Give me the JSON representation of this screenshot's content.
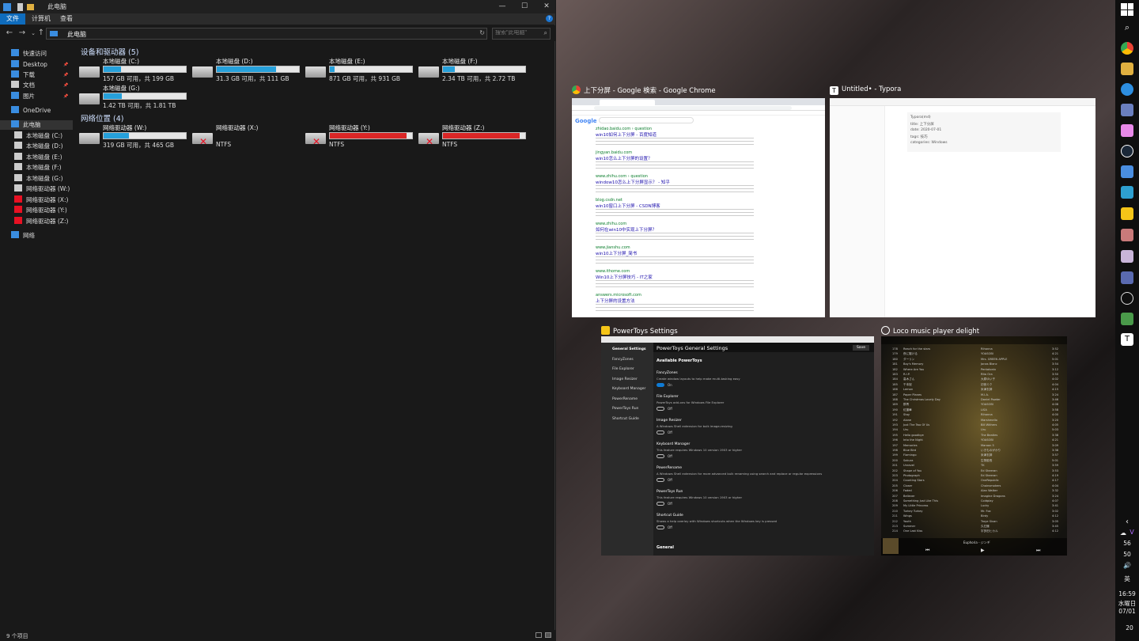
{
  "explorer": {
    "title": "此电脑",
    "ribbon_tabs": [
      "文件",
      "计算机",
      "查看"
    ],
    "address": "此电脑",
    "search_placeholder": "搜索\"此电脑\"",
    "sidebar": [
      {
        "label": "快速访问",
        "icon": "star-icon",
        "color": "#3a8de0"
      },
      {
        "label": "Desktop",
        "icon": "desktop-icon",
        "color": "#3a8de0",
        "pinned": true
      },
      {
        "label": "下载",
        "icon": "download-icon",
        "color": "#3a8de0",
        "pinned": true
      },
      {
        "label": "文档",
        "icon": "document-icon",
        "color": "#cccccc",
        "pinned": true
      },
      {
        "label": "图片",
        "icon": "picture-icon",
        "color": "#3a8de0",
        "pinned": true
      },
      {
        "label": "OneDrive",
        "icon": "cloud-icon",
        "color": "#3a8de0"
      },
      {
        "label": "此电脑",
        "icon": "computer-icon",
        "color": "#3a8de0",
        "selected": true
      },
      {
        "label": "本地磁盘 (C:)",
        "icon": "drive-icon",
        "color": "#cccccc"
      },
      {
        "label": "本地磁盘 (D:)",
        "icon": "drive-icon",
        "color": "#cccccc"
      },
      {
        "label": "本地磁盘 (E:)",
        "icon": "drive-icon",
        "color": "#cccccc"
      },
      {
        "label": "本地磁盘 (F:)",
        "icon": "drive-icon",
        "color": "#cccccc"
      },
      {
        "label": "本地磁盘 (G:)",
        "icon": "drive-icon",
        "color": "#cccccc"
      },
      {
        "label": "网络驱动器 (W:)",
        "icon": "network-drive-icon",
        "color": "#cccccc"
      },
      {
        "label": "网络驱动器 (X:)",
        "icon": "network-drive-icon",
        "color": "#e81123"
      },
      {
        "label": "网络驱动器 (Y:)",
        "icon": "network-drive-icon",
        "color": "#e81123"
      },
      {
        "label": "网络驱动器 (Z:)",
        "icon": "network-drive-icon",
        "color": "#e81123"
      },
      {
        "label": "网络",
        "icon": "network-icon",
        "color": "#3a8de0"
      }
    ],
    "section_devices": "设备和驱动器 (5)",
    "section_network": "网络位置 (4)",
    "drives": [
      {
        "name": "本地磁盘 (C:)",
        "info": "157 GB 可用，共 199 GB",
        "used": 0.21
      },
      {
        "name": "本地磁盘 (D:)",
        "info": "31.3 GB 可用，共 111 GB",
        "used": 0.72
      },
      {
        "name": "本地磁盘 (E:)",
        "info": "871 GB 可用，共 931 GB",
        "used": 0.06
      },
      {
        "name": "本地磁盘 (F:)",
        "info": "2.34 TB 可用，共 2.72 TB",
        "used": 0.14
      },
      {
        "name": "本地磁盘 (G:)",
        "info": "1.42 TB 可用，共 1.81 TB",
        "used": 0.22
      }
    ],
    "network_drives": [
      {
        "name": "网络驱动器 (W:)",
        "info": "319 GB 可用，共 465 GB",
        "used": 0.31,
        "disconnected": false
      },
      {
        "name": "网络驱动器 (X:)",
        "info": "NTFS",
        "used": 0,
        "disconnected": true
      },
      {
        "name": "网络驱动器 (Y:)",
        "info": "NTFS",
        "used": 0.93,
        "disconnected": true
      },
      {
        "name": "网络驱动器 (Z:)",
        "info": "NTFS",
        "used": 0.93,
        "disconnected": true
      }
    ],
    "status": "9 个项目"
  },
  "windows": {
    "chrome": {
      "title": "上下分屏 - Google 検索 - Google Chrome"
    },
    "typora": {
      "title": "Untitled• - Typora"
    },
    "powertoys": {
      "title": "PowerToys Settings"
    },
    "loco": {
      "title": "Loco music player delight"
    }
  },
  "chrome_results": [
    {
      "url": "zhidao.baidu.com › question",
      "title": "win10如何上下分屏 - 百度知道"
    },
    {
      "url": "jingyan.baidu.com",
      "title": "win10怎么上下分屏的设置？"
    },
    {
      "url": "www.zhihu.com › question",
      "title": "window10怎么上下分屏显示？ - 知乎"
    },
    {
      "url": "blog.csdn.net",
      "title": "win10窗口上下分屏 - CSDN博客"
    },
    {
      "url": "www.zhihu.com",
      "title": "如何在win10中实现上下分屏？"
    },
    {
      "url": "www.jianshu.com",
      "title": "win10上下分屏_简书"
    },
    {
      "url": "www.ithome.com",
      "title": "Win10上下分屏技巧 - IT之家"
    },
    {
      "url": "answers.microsoft.com",
      "title": "上下分屏的设置方法"
    }
  ],
  "typora_meta": [
    "Typora(md)",
    "title: 上下分屏",
    "date: 2020-07-01",
    "tags: 技巧",
    "categories: Windows"
  ],
  "powertoys": {
    "header": "PowerToys General Settings",
    "save": "Save",
    "nav": [
      "General Settings",
      "FancyZones",
      "File Explorer",
      "Image Resizer",
      "Keyboard Manager",
      "PowerRename",
      "PowerToys Run",
      "Shortcut Guide"
    ],
    "available": "Available PowerToys",
    "items": [
      {
        "name": "FancyZones",
        "desc": "Create window layouts to help make multi-tasking easy",
        "state": "On"
      },
      {
        "name": "File Explorer",
        "desc": "PowerToys add-ons for Windows File Explorer",
        "state": "Off"
      },
      {
        "name": "Image Resizer",
        "desc": "A Windows Shell extension for bulk image-resizing",
        "state": "Off"
      },
      {
        "name": "Keyboard Manager",
        "desc": "This feature requires Windows 10 version 1903 or higher",
        "state": "Off"
      },
      {
        "name": "PowerRename",
        "desc": "A Windows Shell extension for more advanced bulk renaming using search and replace or regular expressions",
        "state": "Off"
      },
      {
        "name": "PowerToys Run",
        "desc": "This feature requires Windows 10 version 1903 or higher",
        "state": "Off"
      },
      {
        "name": "Shortcut Guide",
        "desc": "Shows a help overlay with Windows shortcuts when the Windows key is pressed",
        "state": "Off"
      }
    ],
    "general": "General"
  },
  "loco_rows": [
    {
      "n": "178",
      "t": "Reach for the stars",
      "a": "Rihanna",
      "d": "3:52"
    },
    {
      "n": "179",
      "t": "夜に駆ける",
      "a": "YOASOBI",
      "d": "4:21"
    },
    {
      "n": "180",
      "t": "ダーリン",
      "a": "Mrs. GREEN APPLE",
      "d": "5:01"
    },
    {
      "n": "181",
      "t": "Boy's Memory",
      "a": "Jonas Blanc",
      "d": "3:54"
    },
    {
      "n": "182",
      "t": "Where Are You",
      "a": "Pentatonix",
      "d": "3:12"
    },
    {
      "n": "183",
      "t": "R.I.P.",
      "a": "Rita Ora",
      "d": "3:50"
    },
    {
      "n": "184",
      "t": "高木さん",
      "a": "大原ゆい子",
      "d": "4:02"
    },
    {
      "n": "185",
      "t": "千本桜",
      "a": "初音ミク",
      "d": "4:04"
    },
    {
      "n": "186",
      "t": "Lemon",
      "a": "米津玄師",
      "d": "4:15"
    },
    {
      "n": "187",
      "t": "Paper Planes",
      "a": "M.I.A.",
      "d": "3:24"
    },
    {
      "n": "188",
      "t": "The Christmas Lovely Day",
      "a": "Daniel Powter",
      "d": "3:46"
    },
    {
      "n": "189",
      "t": "群青",
      "a": "YOASOBI",
      "d": "4:08"
    },
    {
      "n": "190",
      "t": "紅蓮華",
      "a": "LiSA",
      "d": "3:58"
    },
    {
      "n": "191",
      "t": "Stay",
      "a": "Rihanna",
      "d": "4:00"
    },
    {
      "n": "192",
      "t": "Alone",
      "a": "Marshmello",
      "d": "3:20"
    },
    {
      "n": "193",
      "t": "Just The Two Of Us",
      "a": "Bill Withers",
      "d": "4:05"
    },
    {
      "n": "194",
      "t": "Uru",
      "a": "Uru",
      "d": "5:03"
    },
    {
      "n": "195",
      "t": "Hello goodbye",
      "a": "The Beatles",
      "d": "3:38"
    },
    {
      "n": "196",
      "t": "Into the Night",
      "a": "YOASOBI",
      "d": "4:21"
    },
    {
      "n": "197",
      "t": "Memories",
      "a": "Maroon 5",
      "d": "3:09"
    },
    {
      "n": "198",
      "t": "Blue Bird",
      "a": "いきものがかり",
      "d": "3:38"
    },
    {
      "n": "199",
      "t": "Flamingo",
      "a": "米津玄師",
      "d": "3:57"
    },
    {
      "n": "200",
      "t": "Sakura",
      "a": "生物股長",
      "d": "5:01"
    },
    {
      "n": "201",
      "t": "Unravel",
      "a": "TK",
      "d": "3:59"
    },
    {
      "n": "202",
      "t": "Shape of You",
      "a": "Ed Sheeran",
      "d": "3:53"
    },
    {
      "n": "203",
      "t": "Photograph",
      "a": "Ed Sheeran",
      "d": "4:19"
    },
    {
      "n": "204",
      "t": "Counting Stars",
      "a": "OneRepublic",
      "d": "4:17"
    },
    {
      "n": "205",
      "t": "Closer",
      "a": "Chainsmokers",
      "d": "4:04"
    },
    {
      "n": "206",
      "t": "Faded",
      "a": "Alan Walker",
      "d": "3:32"
    },
    {
      "n": "207",
      "t": "Believer",
      "a": "Imagine Dragons",
      "d": "3:24"
    },
    {
      "n": "208",
      "t": "Something Just Like This",
      "a": "Coldplay",
      "d": "4:07"
    },
    {
      "n": "209",
      "t": "My Little Princess",
      "a": "Lucky",
      "d": "3:41"
    },
    {
      "n": "210",
      "t": "Turkey Turkey",
      "a": "Mr. Fox",
      "d": "3:02"
    },
    {
      "n": "211",
      "t": "Wings",
      "a": "Birdy",
      "d": "4:12"
    },
    {
      "n": "212",
      "t": "Youth",
      "a": "Troye Sivan",
      "d": "3:05"
    },
    {
      "n": "213",
      "t": "Summer",
      "a": "久石譲",
      "d": "3:45"
    },
    {
      "n": "214",
      "t": "One Last Kiss",
      "a": "宇多田ヒカル",
      "d": "4:12"
    }
  ],
  "loco_now": "Euphoria - ジンギ",
  "taskbar": {
    "num1": "56",
    "num2": "50",
    "ime": "英",
    "time": "16:59",
    "weekday": "水曜日",
    "date": "07/01",
    "notifications": "20"
  }
}
